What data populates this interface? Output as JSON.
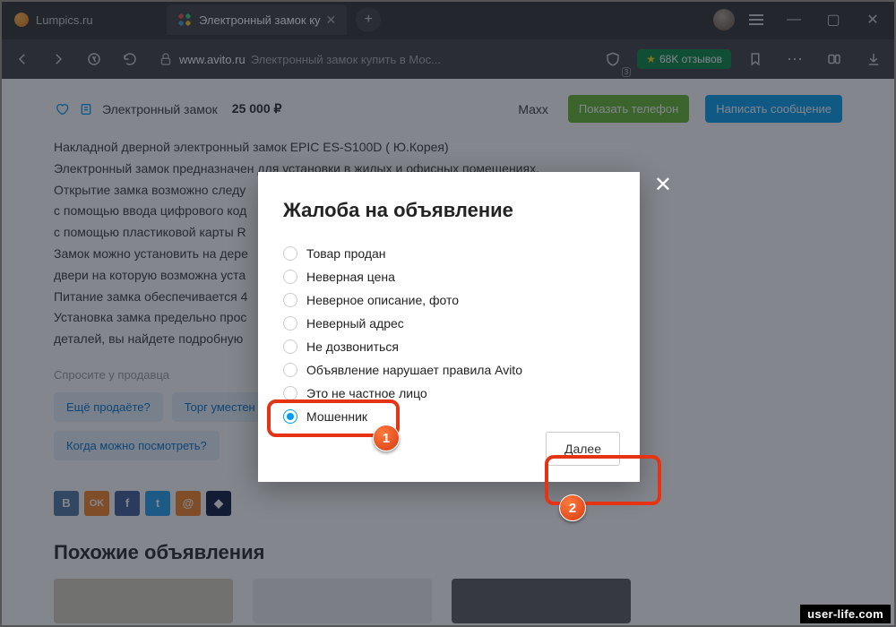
{
  "browser": {
    "tabs": [
      {
        "title": "Lumpics.ru",
        "favicon": "orange",
        "active": false
      },
      {
        "title": "Электронный замок ку",
        "favicon": "dots",
        "active": true
      }
    ],
    "new_tab": "+",
    "address": {
      "lock": true,
      "domain": "www.avito.ru",
      "title": "Электронный замок купить в Мос..."
    },
    "shield_badge": "3",
    "reviews_btn": "68K отзывов",
    "window_buttons": {
      "min": "—",
      "max": "▢",
      "close": "✕"
    }
  },
  "listing": {
    "title": "Электронный замок",
    "price": "25 000  ₽",
    "seller": "Maxx",
    "btn_phone": "Показать телефон",
    "btn_msg": "Написать сообщение",
    "description": [
      "Накладной  дверной электронный замок EPIC ES-S100D ( Ю.Корея)",
      "Электронный замок предназначен для установки в жилых и офисных помещениях.",
      "Открытие замка возможно следу",
      " с помощью ввода цифрового код",
      " с помощью пластиковой карты R",
      "Замок можно установить на дере",
      "двери на которую возможна уста",
      "Питание замка обеспечивается 4",
      "Установка замка предельно прос",
      "деталей, вы найдете подробную"
    ],
    "ask_label": "Спросите у продавца",
    "chips": [
      "Ещё продаёте?",
      "Торг уместен",
      "Когда можно посмотреть?"
    ],
    "socials": [
      {
        "label": "В",
        "color": "#4c75a3"
      },
      {
        "label": "OK",
        "color": "#f58220"
      },
      {
        "label": "f",
        "color": "#3b5998"
      },
      {
        "label": "t",
        "color": "#1da1f2"
      },
      {
        "label": "@",
        "color": "#f58220"
      },
      {
        "label": "◆",
        "color": "#07163f"
      }
    ],
    "similar_heading": "Похожие объявления"
  },
  "modal": {
    "title": "Жалоба на объявление",
    "options": [
      "Товар продан",
      "Неверная цена",
      "Неверное описание, фото",
      "Неверный адрес",
      "Не дозвониться",
      "Объявление нарушает правила Avito",
      "Это не частное лицо",
      "Мошенник"
    ],
    "selected_index": 7,
    "next_btn": "Далее",
    "close": "✕"
  },
  "callouts": {
    "one": "1",
    "two": "2"
  },
  "watermark": "user-life.com"
}
